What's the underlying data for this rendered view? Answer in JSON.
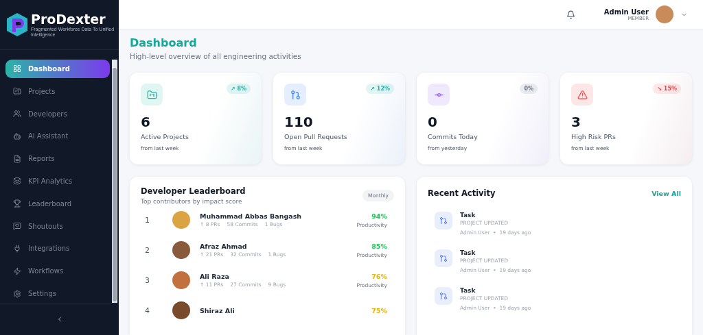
{
  "brand": {
    "name": "ProDexter",
    "tagline": "Fragmented Workforce Data To Unified Intelligence"
  },
  "sidebar": {
    "items": [
      {
        "label": "Dashboard",
        "selected": true
      },
      {
        "label": "Projects",
        "selected": false
      },
      {
        "label": "Developers",
        "selected": false
      },
      {
        "label": "Ai Assistant",
        "selected": false
      },
      {
        "label": "Reports",
        "selected": false
      },
      {
        "label": "KPI Analytics",
        "selected": false
      },
      {
        "label": "Leaderboard",
        "selected": false
      },
      {
        "label": "Shoutouts",
        "selected": false
      },
      {
        "label": "Integrations",
        "selected": false
      },
      {
        "label": "Workflows",
        "selected": false
      },
      {
        "label": "Settings",
        "selected": false
      }
    ]
  },
  "header": {
    "user_name": "Admin User",
    "user_role": "MEMBER"
  },
  "page": {
    "title": "Dashboard",
    "subtitle": "High-level overview of all engineering activities"
  },
  "stats": [
    {
      "kind": "folder",
      "color": "#14b8a6",
      "badge": {
        "text": "↗ 8%",
        "color": "#14b8a6"
      },
      "value": "6",
      "label": "Active Projects",
      "note": "from last week"
    },
    {
      "kind": "pull",
      "color": "#3b82f6",
      "badge": {
        "text": "↗ 12%",
        "color": "#14b8a6"
      },
      "value": "110",
      "label": "Open Pull Requests",
      "note": "from last week"
    },
    {
      "kind": "commit",
      "color": "#8b5cf6",
      "badge": {
        "text": "0%",
        "color": "#6b7280"
      },
      "value": "0",
      "label": "Commits Today",
      "note": "from yesterday"
    },
    {
      "kind": "alert",
      "color": "#ef4444",
      "badge": {
        "text": "↘ 15%",
        "color": "#ef4444"
      },
      "value": "3",
      "label": "High Risk PRs",
      "note": "from last week"
    }
  ],
  "leaderboard": {
    "title": "Developer Leaderboard",
    "subtitle": "Top contributors by impact score",
    "period": "Monthly",
    "rows": [
      {
        "rank": "1",
        "name": "Muhammad Abbas Bangash",
        "prs": "↑ 8 PRs",
        "commits": "58 Commits",
        "bugs": "1 Bugs",
        "score": "94%",
        "score_label": "Productivity",
        "color": "#22c55e"
      },
      {
        "rank": "2",
        "name": "Afraz Ahmad",
        "prs": "↑ 21 PRs",
        "commits": "32 Commits",
        "bugs": "1 Bugs",
        "score": "85%",
        "score_label": "Productivity",
        "color": "#22c55e"
      },
      {
        "rank": "3",
        "name": "Ali Raza",
        "prs": "↑ 11 PRs",
        "commits": "27 Commits",
        "bugs": "9 Bugs",
        "score": "76%",
        "score_label": "Productivity",
        "color": "#eab308"
      },
      {
        "rank": "4",
        "name": "Shiraz Ali",
        "score": "75%",
        "color": "#eab308"
      }
    ]
  },
  "activity": {
    "title": "Recent Activity",
    "link": "View All",
    "items": [
      {
        "title": "Task",
        "type": "PROJECT UPDATED",
        "user": "Admin User",
        "separator": "•",
        "time": "19 days ago"
      },
      {
        "title": "Task",
        "type": "PROJECT UPDATED",
        "user": "Admin User",
        "separator": "•",
        "time": "19 days ago"
      },
      {
        "title": "Task",
        "type": "PROJECT UPDATED",
        "user": "Admin User",
        "separator": "•",
        "time": "19 days ago"
      }
    ]
  }
}
